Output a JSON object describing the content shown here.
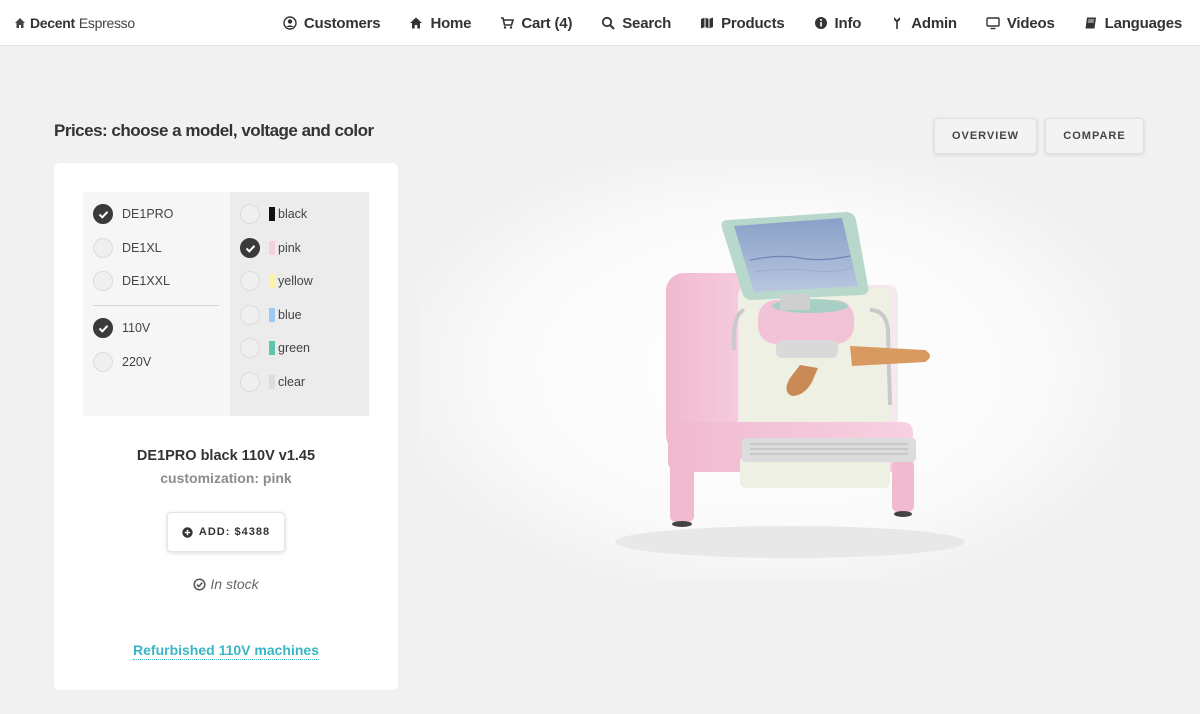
{
  "brand": {
    "bold": "Decent",
    "light": "Espresso"
  },
  "nav": [
    {
      "label": "Customers",
      "icon": "user-circle-icon"
    },
    {
      "label": "Home",
      "icon": "home-icon"
    },
    {
      "label": "Cart (4)",
      "icon": "cart-icon"
    },
    {
      "label": "Search",
      "icon": "search-icon"
    },
    {
      "label": "Products",
      "icon": "map-icon"
    },
    {
      "label": "Info",
      "icon": "info-icon"
    },
    {
      "label": "Admin",
      "icon": "admin-icon"
    },
    {
      "label": "Videos",
      "icon": "monitor-icon"
    },
    {
      "label": "Languages",
      "icon": "book-icon"
    }
  ],
  "page": {
    "title": "Prices: choose a model, voltage and color",
    "overview_label": "OVERVIEW",
    "compare_label": "COMPARE"
  },
  "options": {
    "models": [
      {
        "label": "DE1PRO",
        "selected": true
      },
      {
        "label": "DE1XL",
        "selected": false
      },
      {
        "label": "DE1XXL",
        "selected": false
      }
    ],
    "voltages": [
      {
        "label": "110V",
        "selected": true
      },
      {
        "label": "220V",
        "selected": false
      }
    ],
    "colors": [
      {
        "label": "black",
        "swatch": "#111111",
        "selected": false
      },
      {
        "label": "pink",
        "swatch": "#f7cfe0",
        "selected": true
      },
      {
        "label": "yellow",
        "swatch": "#fbf3a8",
        "selected": false
      },
      {
        "label": "blue",
        "swatch": "#9fc8f2",
        "selected": false
      },
      {
        "label": "green",
        "swatch": "#5fc4ad",
        "selected": false
      },
      {
        "label": "clear",
        "swatch": "#dcdcdc",
        "selected": false
      }
    ]
  },
  "product": {
    "name": "DE1PRO black 110V v1.45",
    "customization": "customization: pink",
    "add_label": "ADD: $4388",
    "stock": "In stock",
    "refurb_link": "Refurbished 110V machines"
  },
  "colors": {
    "accent_link": "#39b6c4",
    "machine_body": "#f2c2d6"
  }
}
